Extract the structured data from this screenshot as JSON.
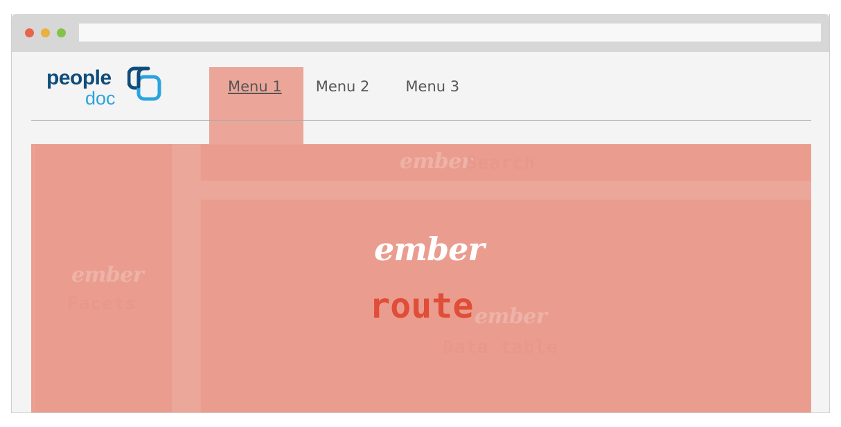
{
  "logo": {
    "word_people": "people",
    "word_doc": "doc",
    "colors": {
      "people": "#0f4c7a",
      "doc": "#2aa4e0"
    }
  },
  "nav": {
    "items": [
      {
        "label": "Menu 1",
        "active": true
      },
      {
        "label": "Menu 2",
        "active": false
      },
      {
        "label": "Menu 3",
        "active": false
      }
    ]
  },
  "overlay": {
    "ember_text": "ember",
    "route_label": "route",
    "facets": {
      "ember": "ember",
      "label": "Facets"
    },
    "search": {
      "ember": "ember",
      "label": "Search"
    },
    "datatable": {
      "ember": "ember",
      "label": "Data table"
    },
    "colors": {
      "route_fill": "#ea9f91",
      "route_label": "#e04d38"
    }
  }
}
